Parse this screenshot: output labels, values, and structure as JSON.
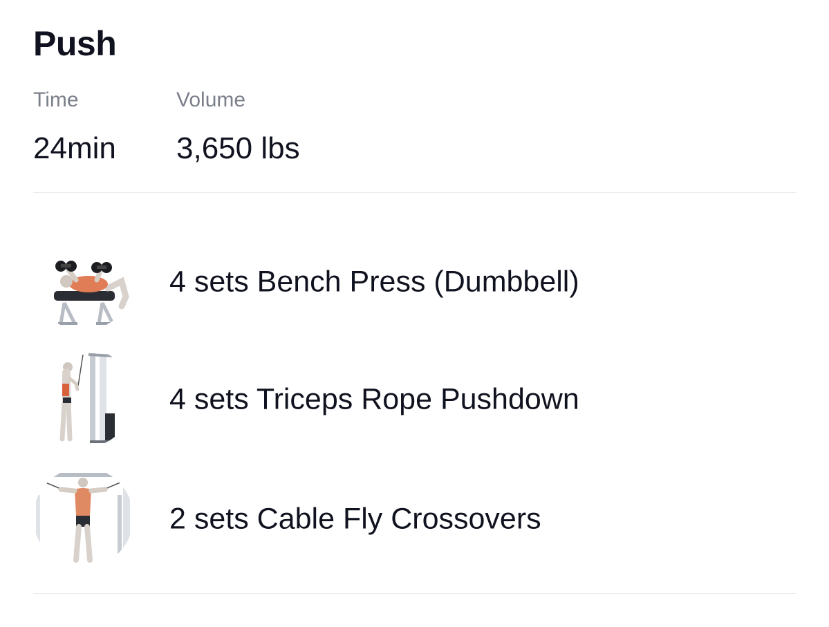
{
  "workout": {
    "title": "Push",
    "stats": {
      "time": {
        "label": "Time",
        "value": "24min"
      },
      "volume": {
        "label": "Volume",
        "value": "3,650 lbs"
      }
    },
    "exercises": [
      {
        "text": "4 sets Bench Press (Dumbbell)",
        "icon": "bench-press-illustration"
      },
      {
        "text": "4 sets Triceps Rope Pushdown",
        "icon": "triceps-rope-pushdown-illustration"
      },
      {
        "text": "2 sets Cable Fly Crossovers",
        "icon": "cable-fly-illustration"
      }
    ]
  }
}
